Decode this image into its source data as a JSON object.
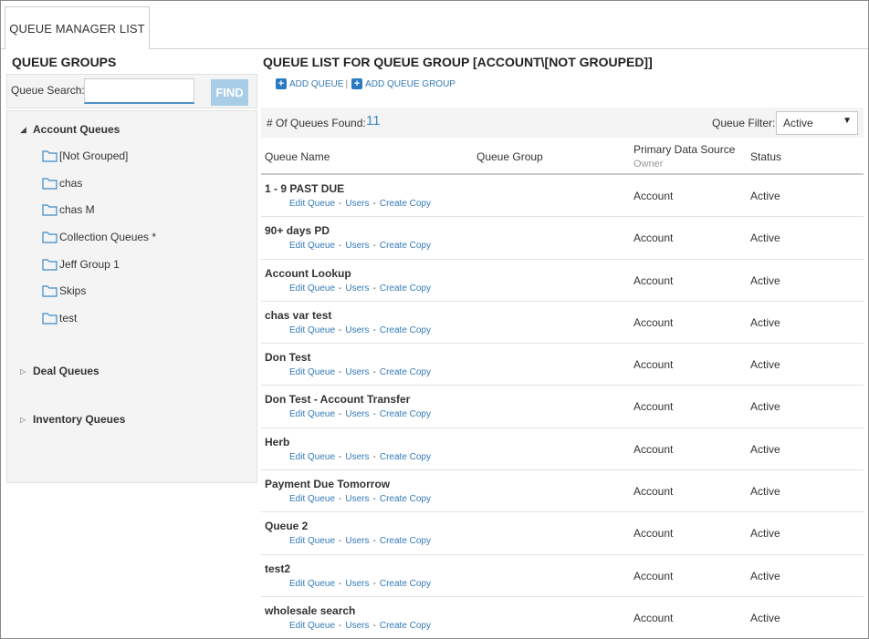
{
  "tabs": [
    {
      "label": "QUEUE MANAGER LIST"
    }
  ],
  "left": {
    "title": "QUEUE GROUPS",
    "search": {
      "label": "Queue Search:",
      "value": "",
      "button": "FIND"
    },
    "tree": [
      {
        "label": "Account Queues",
        "expanded": true,
        "children": [
          "[Not Grouped]",
          "chas",
          "chas M",
          "Collection Queues *",
          "Jeff Group 1",
          "Skips",
          "test"
        ]
      },
      {
        "label": "Deal Queues",
        "expanded": false
      },
      {
        "label": "Inventory Queues",
        "expanded": false
      }
    ]
  },
  "right": {
    "title": "QUEUE LIST FOR QUEUE GROUP [ACCOUNT\\[NOT GROUPED]]",
    "add_queue": "ADD QUEUE",
    "add_separator": "|",
    "add_queue_group": "ADD QUEUE GROUP",
    "found_label": "# Of Queues Found:",
    "found_count": "11",
    "filter_label": "Queue Filter:",
    "filter_value": "Active",
    "columns": {
      "name": "Queue Name",
      "group": "Queue Group",
      "source": "Primary Data Source",
      "source_sub": "Owner",
      "status": "Status"
    },
    "action_labels": {
      "edit": "Edit Queue",
      "users": "Users",
      "copy": "Create Copy"
    },
    "rows": [
      {
        "name": "1 - 9 PAST DUE",
        "group": "",
        "source": "Account",
        "status": "Active"
      },
      {
        "name": "90+ days PD",
        "group": "",
        "source": "Account",
        "status": "Active"
      },
      {
        "name": "Account Lookup",
        "group": "",
        "source": "Account",
        "status": "Active"
      },
      {
        "name": "chas var test",
        "group": "",
        "source": "Account",
        "status": "Active"
      },
      {
        "name": "Don Test",
        "group": "",
        "source": "Account",
        "status": "Active"
      },
      {
        "name": "Don Test - Account Transfer",
        "group": "",
        "source": "Account",
        "status": "Active"
      },
      {
        "name": "Herb",
        "group": "",
        "source": "Account",
        "status": "Active"
      },
      {
        "name": "Payment Due Tomorrow",
        "group": "",
        "source": "Account",
        "status": "Active"
      },
      {
        "name": "Queue 2",
        "group": "",
        "source": "Account",
        "status": "Active"
      },
      {
        "name": "test2",
        "group": "",
        "source": "Account",
        "status": "Active"
      },
      {
        "name": "wholesale search",
        "group": "",
        "source": "Account",
        "status": "Active"
      }
    ]
  },
  "colors": {
    "link": "#337ab7",
    "accent": "#3a8bc8",
    "find_button": "#a8cde6"
  }
}
